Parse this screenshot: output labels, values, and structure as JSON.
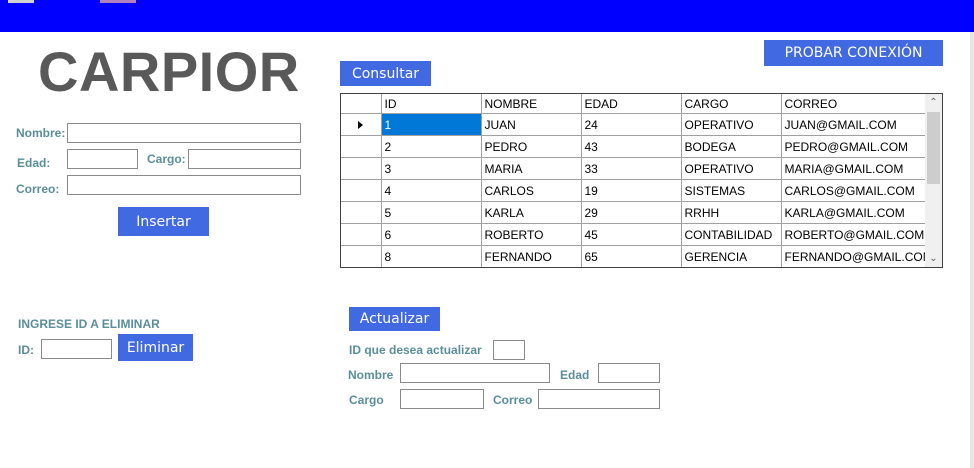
{
  "window": {
    "title_bar_color": "#0000ff"
  },
  "brand": {
    "name": "CARPIOR"
  },
  "toolbar": {
    "test_connection_label": "PROBAR CONEXIÓN",
    "query_label": "Consultar"
  },
  "insert_form": {
    "nombre_label": "Nombre:",
    "edad_label": "Edad:",
    "cargo_label": "Cargo:",
    "correo_label": "Correo:",
    "insert_label": "Insertar",
    "nombre_value": "",
    "edad_value": "",
    "cargo_value": "",
    "correo_value": ""
  },
  "delete_form": {
    "heading": "INGRESE ID A ELIMINAR",
    "id_label": "ID:",
    "id_value": "",
    "delete_label": "Eliminar"
  },
  "update_form": {
    "update_label": "Actualizar",
    "id_label": "ID que desea actualizar",
    "nombre_label": "Nombre",
    "edad_label": "Edad",
    "cargo_label": "Cargo",
    "correo_label": "Correo"
  },
  "grid": {
    "columns": [
      "ID",
      "NOMBRE",
      "EDAD",
      "CARGO",
      "CORREO"
    ],
    "rows": [
      [
        "1",
        "JUAN",
        "24",
        "OPERATIVO",
        "JUAN@GMAIL.COM"
      ],
      [
        "2",
        "PEDRO",
        "43",
        "BODEGA",
        "PEDRO@GMAIL.COM"
      ],
      [
        "3",
        "MARIA",
        "33",
        "OPERATIVO",
        "MARIA@GMAIL.COM"
      ],
      [
        "4",
        "CARLOS",
        "19",
        "SISTEMAS",
        "CARLOS@GMAIL.COM"
      ],
      [
        "5",
        "KARLA",
        "29",
        "RRHH",
        "KARLA@GMAIL.COM"
      ],
      [
        "6",
        "ROBERTO",
        "45",
        "CONTABILIDAD",
        "ROBERTO@GMAIL.COM"
      ],
      [
        "8",
        "FERNANDO",
        "65",
        "GERENCIA",
        "FERNANDO@GMAIL.COM"
      ]
    ],
    "selected_row": 0,
    "scroll_up_icon": "chevron-up-icon",
    "scroll_down_icon": "chevron-down-icon",
    "row_indicator_icon": "current-row-arrow-icon"
  },
  "colors": {
    "accent": "#4169e1",
    "label": "#5a8e9a",
    "brand_text": "#595959",
    "selection": "#0078d7"
  }
}
